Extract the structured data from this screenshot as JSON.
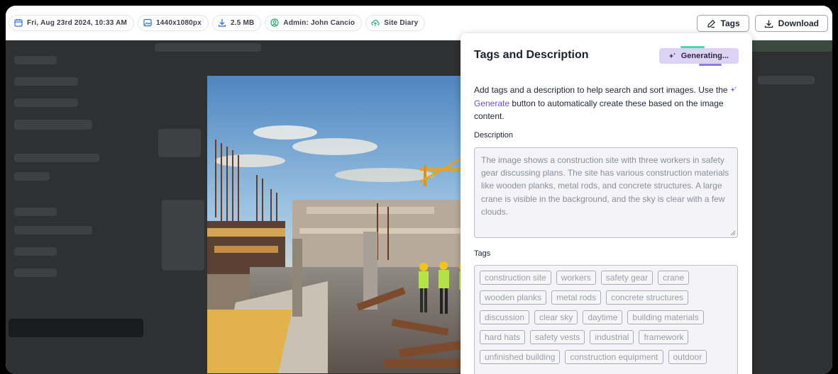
{
  "meta_pills": [
    {
      "icon": "calendar-icon",
      "label": "Fri, Aug 23rd 2024, 10:33 AM"
    },
    {
      "icon": "image-icon",
      "label": "1440x1080px"
    },
    {
      "icon": "download-icon",
      "label": "2.5 MB"
    },
    {
      "icon": "user-icon",
      "label": "Admin: John Cancio"
    },
    {
      "icon": "cloud-upload-icon",
      "label": "Site Diary"
    }
  ],
  "toolbar": {
    "tags_label": "Tags",
    "download_label": "Download"
  },
  "panel": {
    "title": "Tags and Description",
    "generating_label": "Generating...",
    "intro_before": "Add tags and a description to help search and sort images. Use the",
    "intro_link": "Generate",
    "intro_after": "button to automatically create these based on the image content.",
    "description_label": "Description",
    "description_text": "The image shows a construction site with three workers in safety gear discussing plans. The site has various construction materials like wooden planks, metal rods, and concrete structures. A large crane is visible in the background, and the sky is clear with a few clouds.",
    "tags_label": "Tags",
    "tags": [
      [
        "construction site",
        "workers",
        "safety gear",
        "crane"
      ],
      [
        "wooden planks",
        "metal rods",
        "concrete structures"
      ],
      [
        "discussion",
        "clear sky",
        "daytime",
        "building materials"
      ],
      [
        "hard hats",
        "safety vests",
        "industrial",
        "framework"
      ],
      [
        "unfinished building",
        "construction equipment",
        "outdoor"
      ]
    ]
  },
  "colors": {
    "accent": "#6c52d8",
    "generating_bg": "#ddd3f6",
    "meta_icon": "#2f6fd6",
    "user_icon": "#1ea86b"
  }
}
